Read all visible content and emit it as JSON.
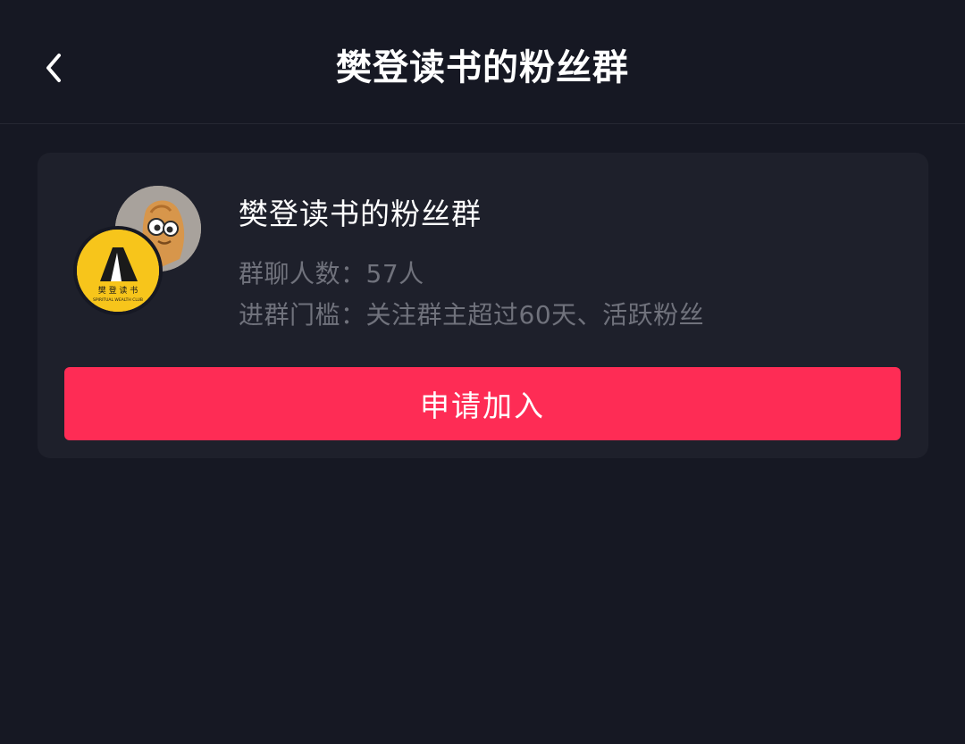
{
  "nav": {
    "back_icon": "chevron-left-icon",
    "title": "樊登读书的粉丝群"
  },
  "group": {
    "name": "樊登读书的粉丝群",
    "member_count_label": "群聊人数：57人",
    "threshold_label": "进群门槛：关注群主超过60天、活跃粉丝",
    "avatar_logo_text": "樊 登 读 书",
    "avatar_logo_subtext": "SPIRITUAL WEALTH CLUB"
  },
  "actions": {
    "join_label": "申请加入"
  },
  "colors": {
    "background": "#161823",
    "card": "#1e202b",
    "primary": "#fe2c55",
    "secondary_text": "#70727c",
    "logo_yellow": "#f7c51b"
  }
}
